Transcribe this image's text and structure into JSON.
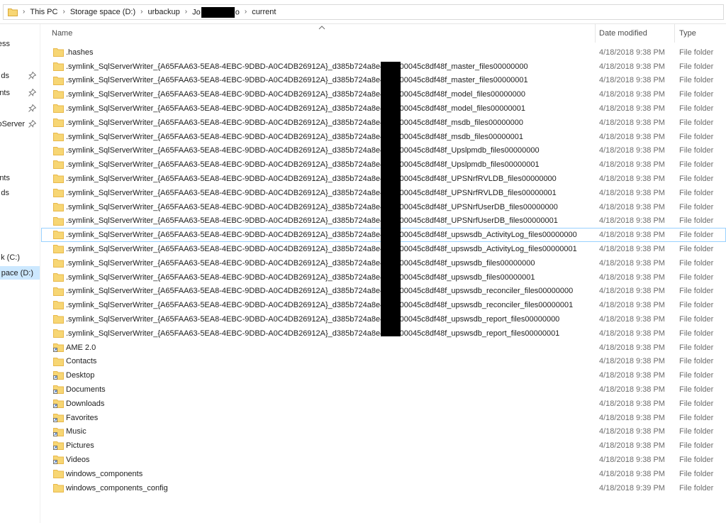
{
  "address_bar": {
    "crumbs": [
      "This PC",
      "Storage space (D:)",
      "urbackup",
      "Jo",
      "o",
      "current"
    ]
  },
  "nav_pane": {
    "items": [
      {
        "label": "ess",
        "pinned": false
      },
      {
        "label": "ds",
        "pinned": true
      },
      {
        "label": "nts",
        "pinned": true
      },
      {
        "label": "",
        "pinned": true
      },
      {
        "label": "oServer",
        "pinned": true
      },
      {
        "label": "nts",
        "pinned": false
      },
      {
        "label": "ds",
        "pinned": false
      },
      {
        "label": "k (C:)",
        "pinned": false
      },
      {
        "label": "pace (D:)",
        "pinned": false,
        "selected": true
      }
    ]
  },
  "columns": {
    "name": "Name",
    "date_modified": "Date modified",
    "type": "Type"
  },
  "files": [
    {
      "name": ".hashes",
      "date": "4/18/2018 9:38 PM",
      "type": "File folder",
      "icon": "folder-icon"
    },
    {
      "name": ".symlink_SqlServerWriter_{A65FAA63-5EA8-4EBC-9DBD-A0C4DB26912A}_d385b724a8e4aa          000045c8df48f_master_files00000000",
      "date": "4/18/2018 9:38 PM",
      "type": "File folder",
      "icon": "folder-icon"
    },
    {
      "name": ".symlink_SqlServerWriter_{A65FAA63-5EA8-4EBC-9DBD-A0C4DB26912A}_d385b724a8e4aa          000045c8df48f_master_files00000001",
      "date": "4/18/2018 9:38 PM",
      "type": "File folder",
      "icon": "folder-icon"
    },
    {
      "name": ".symlink_SqlServerWriter_{A65FAA63-5EA8-4EBC-9DBD-A0C4DB26912A}_d385b724a8e4aa          000045c8df48f_model_files00000000",
      "date": "4/18/2018 9:38 PM",
      "type": "File folder",
      "icon": "folder-icon"
    },
    {
      "name": ".symlink_SqlServerWriter_{A65FAA63-5EA8-4EBC-9DBD-A0C4DB26912A}_d385b724a8e4aa          000045c8df48f_model_files00000001",
      "date": "4/18/2018 9:38 PM",
      "type": "File folder",
      "icon": "folder-icon"
    },
    {
      "name": ".symlink_SqlServerWriter_{A65FAA63-5EA8-4EBC-9DBD-A0C4DB26912A}_d385b724a8e4aa          000045c8df48f_msdb_files00000000",
      "date": "4/18/2018 9:38 PM",
      "type": "File folder",
      "icon": "folder-icon"
    },
    {
      "name": ".symlink_SqlServerWriter_{A65FAA63-5EA8-4EBC-9DBD-A0C4DB26912A}_d385b724a8e4aa          000045c8df48f_msdb_files00000001",
      "date": "4/18/2018 9:38 PM",
      "type": "File folder",
      "icon": "folder-icon"
    },
    {
      "name": ".symlink_SqlServerWriter_{A65FAA63-5EA8-4EBC-9DBD-A0C4DB26912A}_d385b724a8e4aa          000045c8df48f_Upslpmdb_files00000000",
      "date": "4/18/2018 9:38 PM",
      "type": "File folder",
      "icon": "folder-icon"
    },
    {
      "name": ".symlink_SqlServerWriter_{A65FAA63-5EA8-4EBC-9DBD-A0C4DB26912A}_d385b724a8e4aa          000045c8df48f_Upslpmdb_files00000001",
      "date": "4/18/2018 9:38 PM",
      "type": "File folder",
      "icon": "folder-icon"
    },
    {
      "name": ".symlink_SqlServerWriter_{A65FAA63-5EA8-4EBC-9DBD-A0C4DB26912A}_d385b724a8e4aa          000045c8df48f_UPSNrfRVLDB_files00000000",
      "date": "4/18/2018 9:38 PM",
      "type": "File folder",
      "icon": "folder-icon"
    },
    {
      "name": ".symlink_SqlServerWriter_{A65FAA63-5EA8-4EBC-9DBD-A0C4DB26912A}_d385b724a8e4aa          000045c8df48f_UPSNrfRVLDB_files00000001",
      "date": "4/18/2018 9:38 PM",
      "type": "File folder",
      "icon": "folder-icon"
    },
    {
      "name": ".symlink_SqlServerWriter_{A65FAA63-5EA8-4EBC-9DBD-A0C4DB26912A}_d385b724a8e4aa          000045c8df48f_UPSNrfUserDB_files00000000",
      "date": "4/18/2018 9:38 PM",
      "type": "File folder",
      "icon": "folder-icon"
    },
    {
      "name": ".symlink_SqlServerWriter_{A65FAA63-5EA8-4EBC-9DBD-A0C4DB26912A}_d385b724a8e4aa          000045c8df48f_UPSNrfUserDB_files00000001",
      "date": "4/18/2018 9:38 PM",
      "type": "File folder",
      "icon": "folder-icon"
    },
    {
      "name": ".symlink_SqlServerWriter_{A65FAA63-5EA8-4EBC-9DBD-A0C4DB26912A}_d385b724a8e4aa          000045c8df48f_upswsdb_ActivityLog_files00000000",
      "date": "4/18/2018 9:38 PM",
      "type": "File folder",
      "icon": "folder-icon",
      "focused": true
    },
    {
      "name": ".symlink_SqlServerWriter_{A65FAA63-5EA8-4EBC-9DBD-A0C4DB26912A}_d385b724a8e4aa          000045c8df48f_upswsdb_ActivityLog_files00000001",
      "date": "4/18/2018 9:38 PM",
      "type": "File folder",
      "icon": "folder-icon"
    },
    {
      "name": ".symlink_SqlServerWriter_{A65FAA63-5EA8-4EBC-9DBD-A0C4DB26912A}_d385b724a8e4aa          000045c8df48f_upswsdb_files00000000",
      "date": "4/18/2018 9:38 PM",
      "type": "File folder",
      "icon": "folder-icon"
    },
    {
      "name": ".symlink_SqlServerWriter_{A65FAA63-5EA8-4EBC-9DBD-A0C4DB26912A}_d385b724a8e4aa          000045c8df48f_upswsdb_files00000001",
      "date": "4/18/2018 9:38 PM",
      "type": "File folder",
      "icon": "folder-icon"
    },
    {
      "name": ".symlink_SqlServerWriter_{A65FAA63-5EA8-4EBC-9DBD-A0C4DB26912A}_d385b724a8e4aa          000045c8df48f_upswsdb_reconciler_files00000000",
      "date": "4/18/2018 9:38 PM",
      "type": "File folder",
      "icon": "folder-icon"
    },
    {
      "name": ".symlink_SqlServerWriter_{A65FAA63-5EA8-4EBC-9DBD-A0C4DB26912A}_d385b724a8e4aa          000045c8df48f_upswsdb_reconciler_files00000001",
      "date": "4/18/2018 9:38 PM",
      "type": "File folder",
      "icon": "folder-icon"
    },
    {
      "name": ".symlink_SqlServerWriter_{A65FAA63-5EA8-4EBC-9DBD-A0C4DB26912A}_d385b724a8e4aa          000045c8df48f_upswsdb_report_files00000000",
      "date": "4/18/2018 9:38 PM",
      "type": "File folder",
      "icon": "folder-icon"
    },
    {
      "name": ".symlink_SqlServerWriter_{A65FAA63-5EA8-4EBC-9DBD-A0C4DB26912A}_d385b724a8e4aa          000045c8df48f_upswsdb_report_files00000001",
      "date": "4/18/2018 9:38 PM",
      "type": "File folder",
      "icon": "folder-icon"
    },
    {
      "name": "AME 2.0",
      "date": "4/18/2018 9:38 PM",
      "type": "File folder",
      "icon": "folder-shortcut-icon"
    },
    {
      "name": "Contacts",
      "date": "4/18/2018 9:38 PM",
      "type": "File folder",
      "icon": "folder-icon"
    },
    {
      "name": "Desktop",
      "date": "4/18/2018 9:38 PM",
      "type": "File folder",
      "icon": "folder-shortcut-icon"
    },
    {
      "name": "Documents",
      "date": "4/18/2018 9:38 PM",
      "type": "File folder",
      "icon": "folder-shortcut-icon"
    },
    {
      "name": "Downloads",
      "date": "4/18/2018 9:38 PM",
      "type": "File folder",
      "icon": "folder-shortcut-icon"
    },
    {
      "name": "Favorites",
      "date": "4/18/2018 9:38 PM",
      "type": "File folder",
      "icon": "folder-shortcut-icon"
    },
    {
      "name": "Music",
      "date": "4/18/2018 9:38 PM",
      "type": "File folder",
      "icon": "folder-shortcut-icon"
    },
    {
      "name": "Pictures",
      "date": "4/18/2018 9:38 PM",
      "type": "File folder",
      "icon": "folder-shortcut-icon"
    },
    {
      "name": "Videos",
      "date": "4/18/2018 9:38 PM",
      "type": "File folder",
      "icon": "folder-shortcut-icon"
    },
    {
      "name": "windows_components",
      "date": "4/18/2018 9:38 PM",
      "type": "File folder",
      "icon": "folder-icon"
    },
    {
      "name": "windows_components_config",
      "date": "4/18/2018 9:39 PM",
      "type": "File folder",
      "icon": "folder-icon"
    }
  ],
  "colors": {
    "folder_body": "#f7d674",
    "folder_tab": "#e8b84a",
    "selected_bg": "#cce8ff",
    "focus_outline": "#99d1ff",
    "redaction": "#000000"
  }
}
